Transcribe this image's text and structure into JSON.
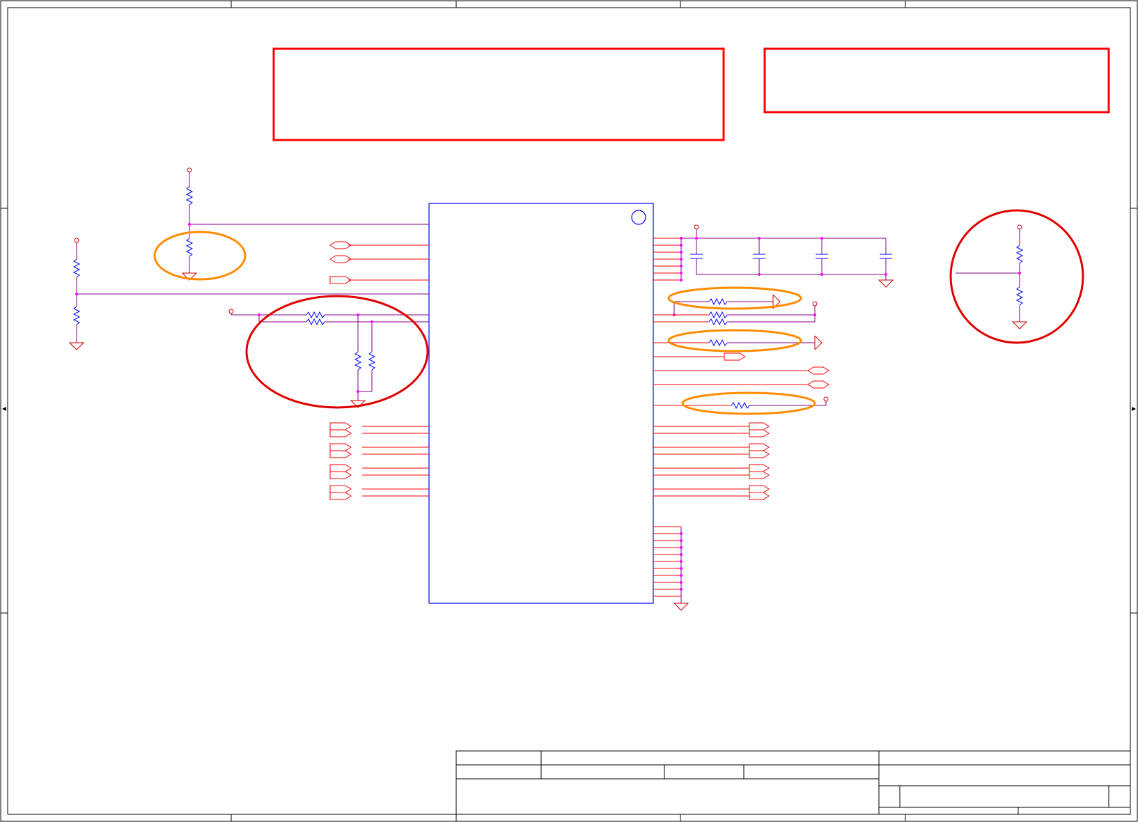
{
  "schematic": {
    "sheet": {
      "border_color": "#000000",
      "frame_color": "#000000"
    },
    "colors": {
      "wire": "#800080",
      "pin": "#ff0000",
      "component": "#0000ff",
      "junction": "#ff00ff",
      "power": "#cc0000",
      "highlight_red": "#ff0000",
      "highlight_orange": "#ff8c00",
      "chip_outline": "#0000ff"
    },
    "annotation_boxes": [
      {
        "name": "note-box-left"
      },
      {
        "name": "note-box-right"
      }
    ],
    "title_block": {
      "rows": 4
    }
  }
}
